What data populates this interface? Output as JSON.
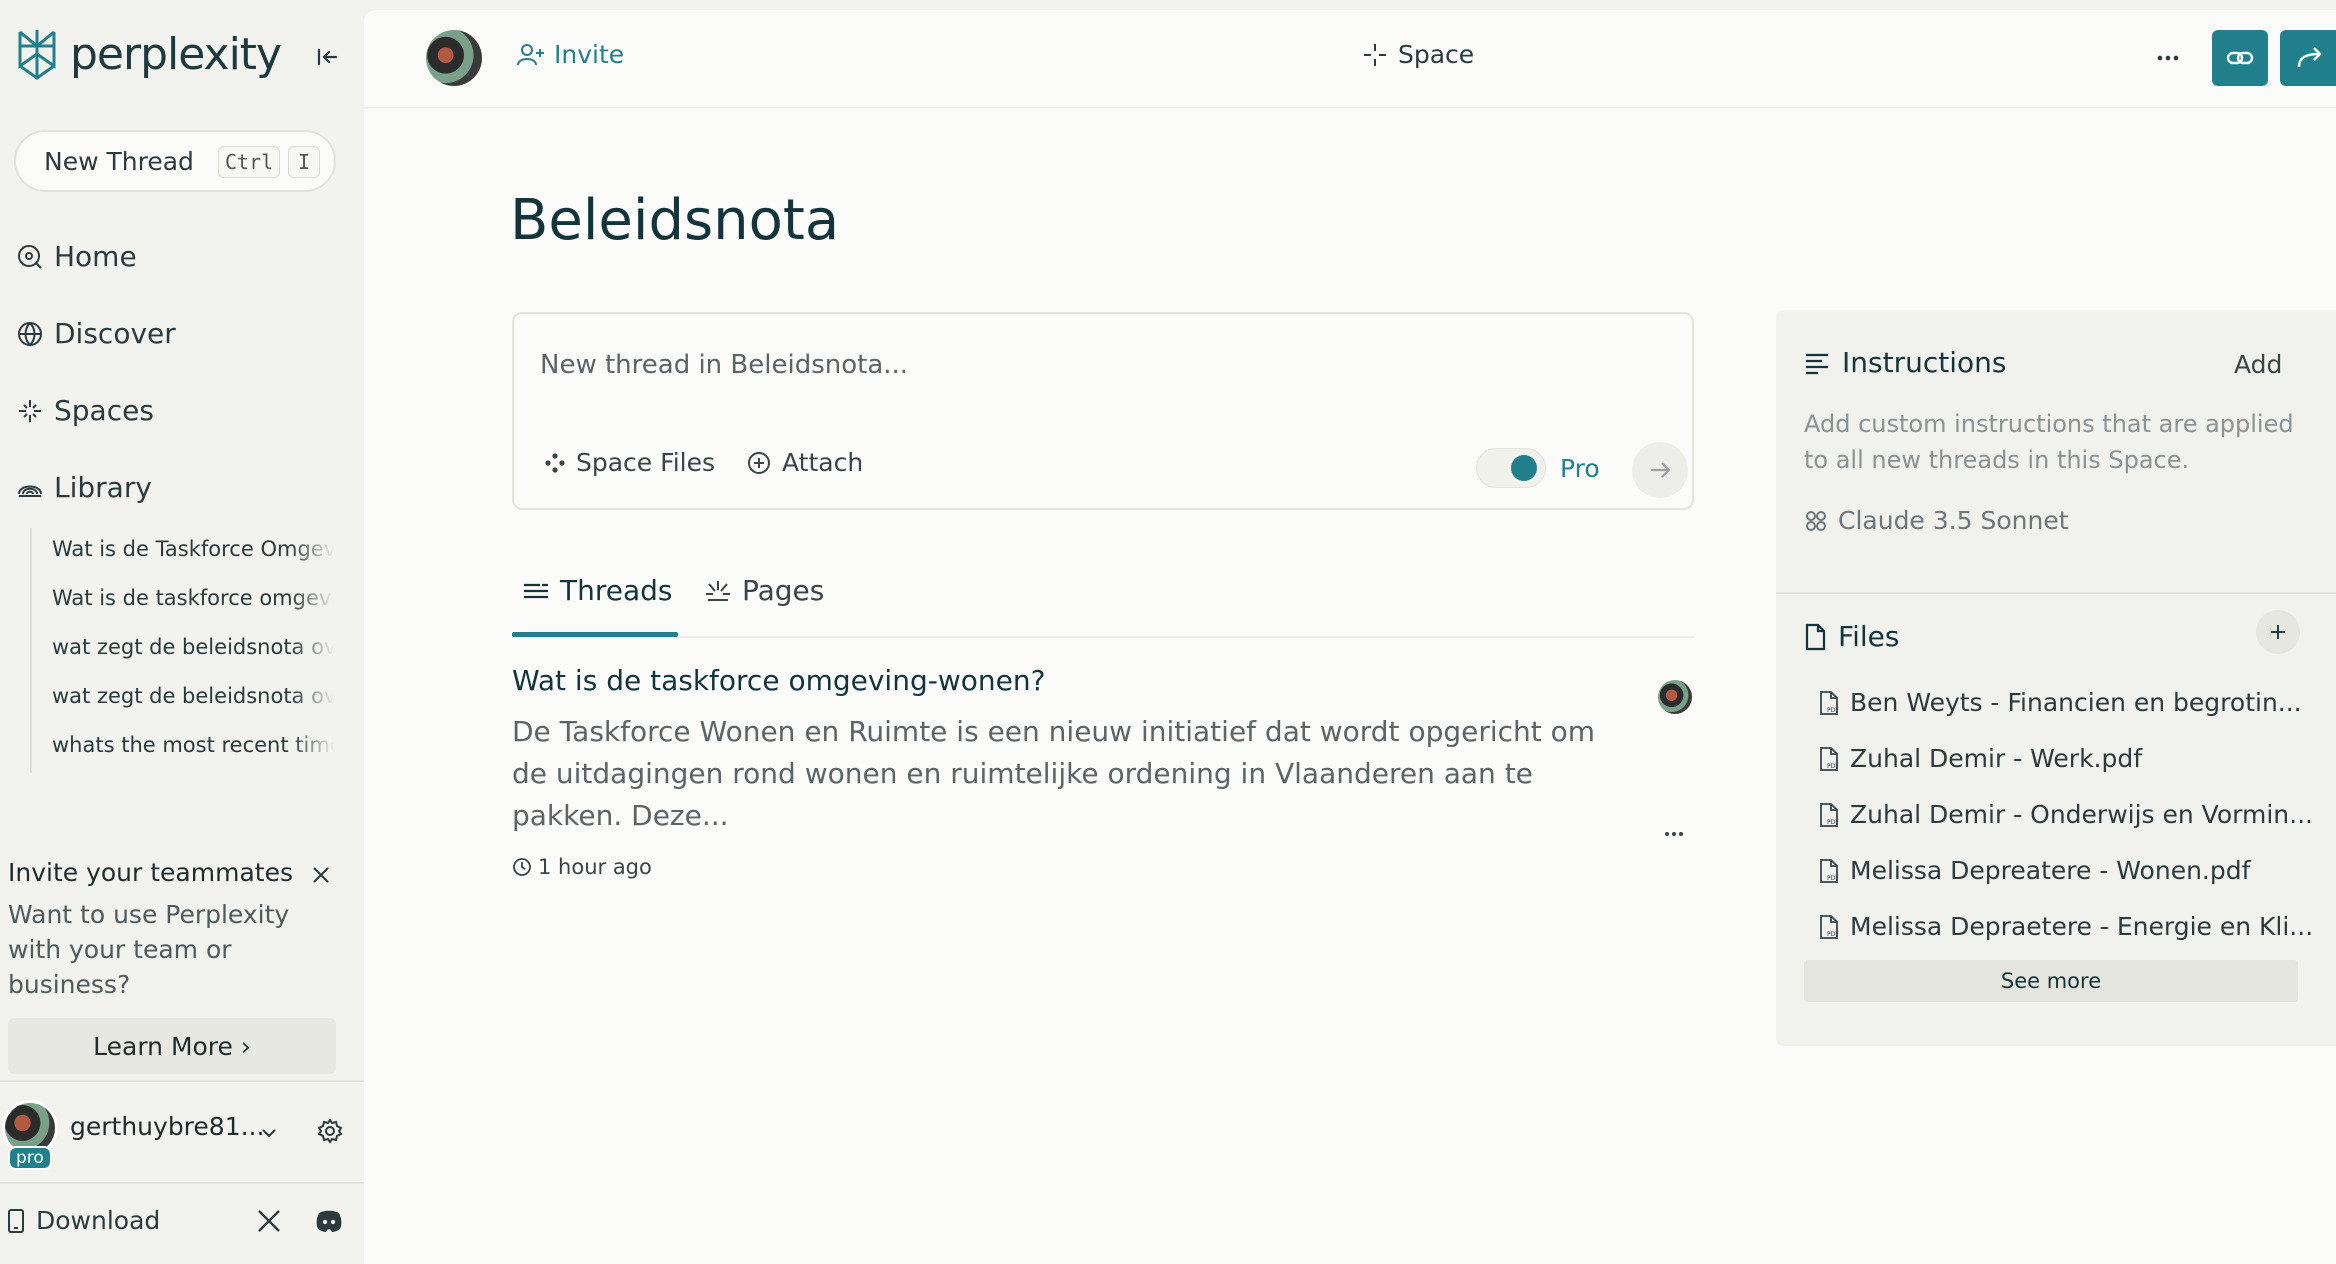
{
  "brand": {
    "name": "perplexity"
  },
  "sidebar": {
    "new_thread_label": "New Thread",
    "shortcut_ctrl": "Ctrl",
    "shortcut_key": "I",
    "nav": [
      {
        "label": "Home",
        "icon": "home-icon"
      },
      {
        "label": "Discover",
        "icon": "globe-icon"
      },
      {
        "label": "Spaces",
        "icon": "sparkle-icon"
      },
      {
        "label": "Library",
        "icon": "library-icon"
      }
    ],
    "history": [
      "Wat is de Taskforce Omgevi",
      "Wat is de taskforce omgevir",
      "wat zegt de beleidsnota ove",
      "wat zegt de beleidsnota ove",
      "whats the most recent time"
    ],
    "invite": {
      "title": "Invite your teammates",
      "subtitle": "Want to use Perplexity with your team or business?",
      "button": "Learn More ›"
    },
    "user": {
      "name": "gerthuybre81...",
      "badge": "pro"
    },
    "download_label": "Download"
  },
  "topbar": {
    "invite_label": "Invite",
    "space_label": "Space"
  },
  "main": {
    "title": "Beleidsnota",
    "composer": {
      "placeholder": "New thread in Beleidsnota...",
      "space_files": "Space Files",
      "attach": "Attach",
      "pro_label": "Pro"
    },
    "tabs": [
      {
        "label": "Threads",
        "active": true
      },
      {
        "label": "Pages",
        "active": false
      }
    ],
    "thread": {
      "title": "Wat is de taskforce omgeving-wonen?",
      "snippet": "De Taskforce Wonen en Ruimte is een nieuw initiatief dat wordt opgericht om de uitdagingen rond wonen en ruimtelijke ordening in Vlaanderen aan te pakken. Deze...",
      "time": "1 hour ago"
    }
  },
  "right_panel": {
    "instructions_title": "Instructions",
    "instructions_add": "Add",
    "instructions_desc": "Add custom instructions that are applied to all new threads in this Space.",
    "model": "Claude 3.5 Sonnet",
    "files_title": "Files",
    "files": [
      "Ben Weyts - Financien en begrotin...",
      "Zuhal Demir - Werk.pdf",
      "Zuhal Demir - Onderwijs en Vormin...",
      "Melissa Depreatere - Wonen.pdf",
      "Melissa Depraetere - Energie en Kli..."
    ],
    "see_more": "See more"
  },
  "colors": {
    "accent": "#22808d",
    "sidebar_bg": "#f2f2ee",
    "main_bg": "#fbfbf9",
    "text_dark": "#13343b"
  }
}
